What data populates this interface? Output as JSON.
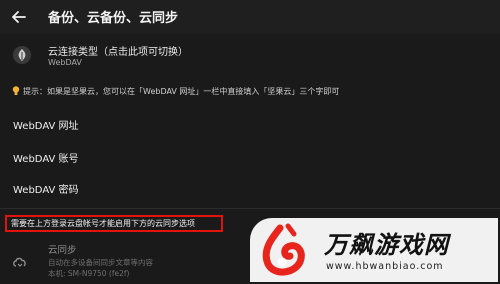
{
  "appbar": {
    "title": "备份、云备份、云同步"
  },
  "cloud_type": {
    "title": "云连接类型（点击此项可切换）",
    "value": "WebDAV"
  },
  "tip": {
    "text": "提示：如果是坚果云，您可以在「WebDAV 网址」一栏中直接填入「坚果云」三个字即可"
  },
  "settings": [
    {
      "label": "WebDAV 网址"
    },
    {
      "label": "WebDAV 账号"
    },
    {
      "label": "WebDAV 密码"
    }
  ],
  "warning": {
    "text": "需要在上方登录云盘帐号才能启用下方的云同步选项"
  },
  "cloud_sync": {
    "title": "云同步",
    "desc": "自动在多设备间同步文章等内容",
    "device": "本机: SM-N9750 (fe2f)"
  },
  "watermark": {
    "cn": "万飙游戏网",
    "url": "www.hbwanbiao.com"
  },
  "colors": {
    "background": "#1a1a1a",
    "warning_border": "#e3120b",
    "tip_bulb": "#f2b233",
    "logo_red": "#e8251d"
  }
}
